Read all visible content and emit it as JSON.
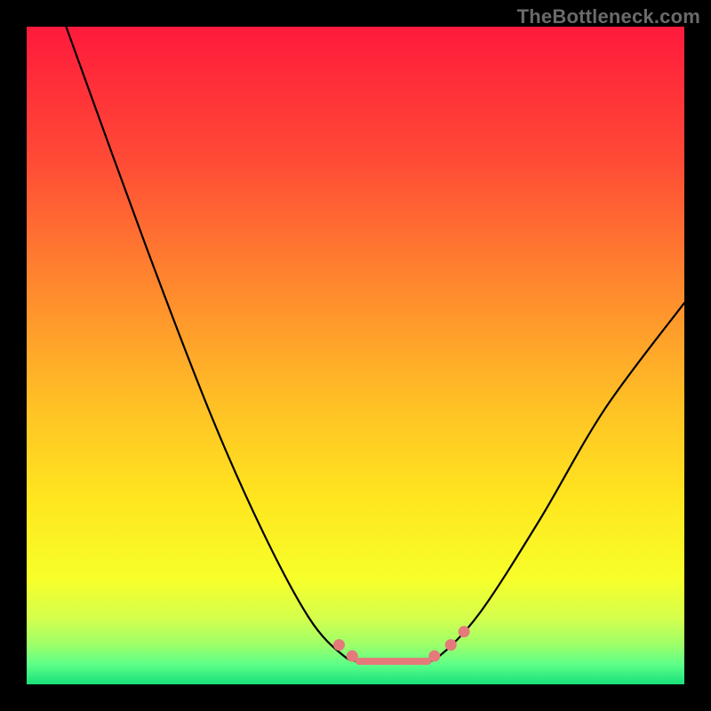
{
  "watermark": "TheBottleneck.com",
  "gradient_stops": [
    {
      "offset": 0.0,
      "color": "#ff1a3c"
    },
    {
      "offset": 0.2,
      "color": "#ff4a36"
    },
    {
      "offset": 0.4,
      "color": "#ff8a2e"
    },
    {
      "offset": 0.58,
      "color": "#ffc225"
    },
    {
      "offset": 0.72,
      "color": "#ffe61f"
    },
    {
      "offset": 0.84,
      "color": "#f7ff2a"
    },
    {
      "offset": 0.9,
      "color": "#d4ff4d"
    },
    {
      "offset": 0.94,
      "color": "#9dff6a"
    },
    {
      "offset": 0.97,
      "color": "#5cff88"
    },
    {
      "offset": 1.0,
      "color": "#18e07a"
    }
  ],
  "curve_color": "#000000",
  "marker_color": "#e47a7a",
  "flat_segment_color": "#e47a7a",
  "chart_data": {
    "type": "line",
    "title": "",
    "xlabel": "",
    "ylabel": "",
    "xlim": [
      0,
      100
    ],
    "ylim": [
      0,
      100
    ],
    "note": "Black V-shaped curve over vertical rainbow heat gradient; valley floor is a flat highlighted segment with markers. Axes/ticks are not rendered; values are proportional estimates read from pixel positions.",
    "series": [
      {
        "name": "curve",
        "points": [
          {
            "x": 6,
            "y": 100
          },
          {
            "x": 18,
            "y": 67
          },
          {
            "x": 28,
            "y": 41
          },
          {
            "x": 36,
            "y": 23
          },
          {
            "x": 43,
            "y": 10
          },
          {
            "x": 48,
            "y": 4.5
          },
          {
            "x": 51,
            "y": 3.5
          },
          {
            "x": 60,
            "y": 3.5
          },
          {
            "x": 63,
            "y": 4.5
          },
          {
            "x": 69,
            "y": 11
          },
          {
            "x": 78,
            "y": 25
          },
          {
            "x": 88,
            "y": 42
          },
          {
            "x": 100,
            "y": 58
          }
        ]
      }
    ],
    "markers": [
      {
        "x": 47.5,
        "y": 6
      },
      {
        "x": 49.5,
        "y": 4.3
      },
      {
        "x": 62.0,
        "y": 4.3
      },
      {
        "x": 64.5,
        "y": 6
      },
      {
        "x": 66.5,
        "y": 8
      }
    ],
    "flat_segment": {
      "x0": 50.5,
      "x1": 61.0,
      "y": 3.5
    }
  }
}
